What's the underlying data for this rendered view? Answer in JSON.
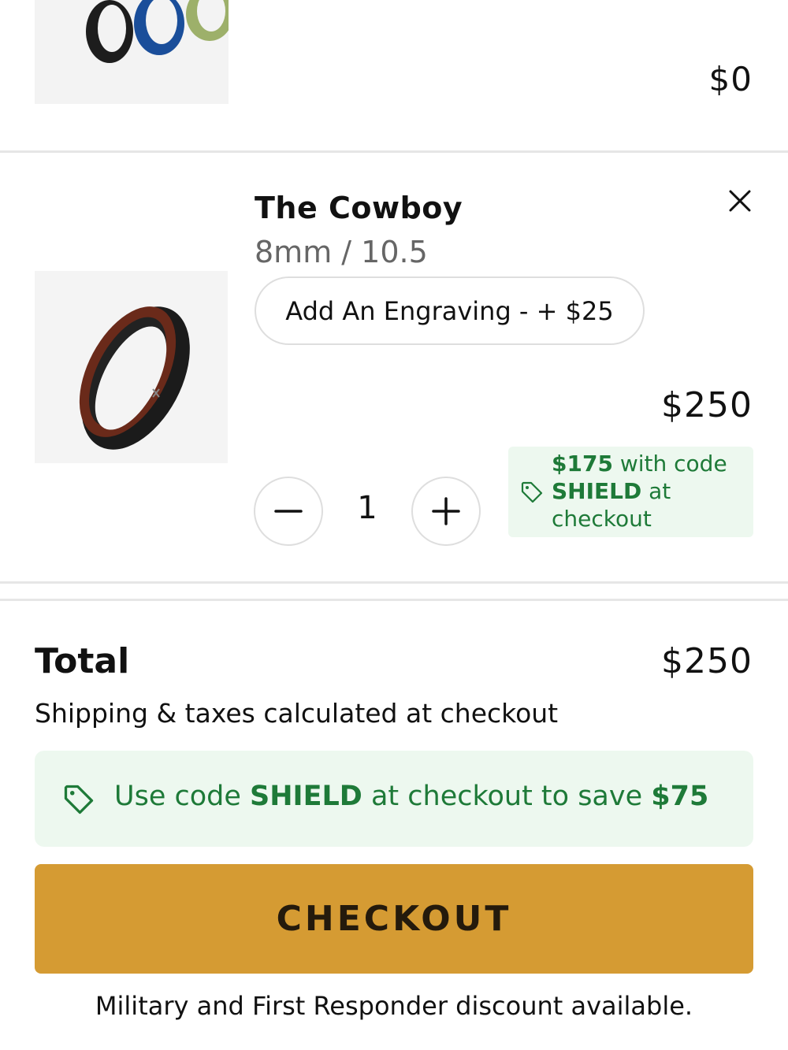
{
  "prev_item": {
    "image_alt": "three silicone rings",
    "price": "$0"
  },
  "cart_item": {
    "title": "The Cowboy",
    "variant": "8mm / 10.5",
    "engraving_label": "Add An Engraving - + $25",
    "price": "$250",
    "quantity": "1",
    "promo": {
      "price": "$175",
      "text1": " with code ",
      "code": "SHIELD",
      "text2": " at checkout"
    },
    "icons": {
      "remove": "close-icon",
      "minus": "minus-icon",
      "plus": "plus-icon",
      "tag": "tag-icon"
    }
  },
  "summary": {
    "total_label": "Total",
    "total_value": "$250",
    "shipping_note": "Shipping & taxes calculated at checkout",
    "save_banner": {
      "prefix": "Use code ",
      "code": "SHIELD",
      "middle": " at checkout to save ",
      "amount": "$75"
    },
    "checkout_label": "CHECKOUT",
    "discount_note": "Military and First Responder discount available."
  },
  "colors": {
    "accent": "#d59b33",
    "promo_bg": "#edf8ef",
    "promo_text": "#1e7a38"
  }
}
